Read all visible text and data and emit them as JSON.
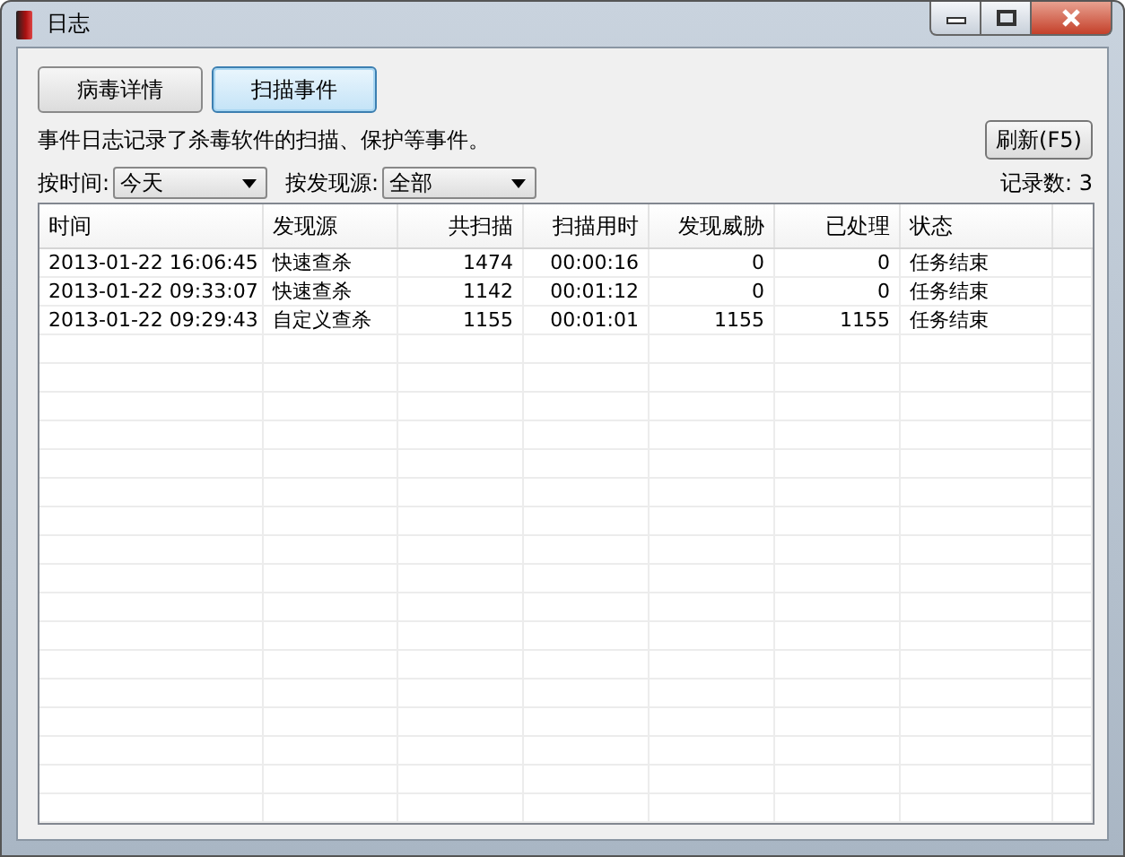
{
  "window": {
    "title": "日志"
  },
  "tabs": [
    {
      "label": "病毒详情",
      "selected": false
    },
    {
      "label": "扫描事件",
      "selected": true
    }
  ],
  "description": "事件日志记录了杀毒软件的扫描、保护等事件。",
  "refresh_button": "刷新(F5)",
  "filters": [
    {
      "label": "按时间:",
      "value": "今天"
    },
    {
      "label": "按发现源:",
      "value": "全部"
    }
  ],
  "record_count": "记录数: 3",
  "table": {
    "columns": [
      {
        "label": "时间",
        "kind": "text"
      },
      {
        "label": "发现源",
        "kind": "text"
      },
      {
        "label": "共扫描",
        "kind": "number"
      },
      {
        "label": "扫描用时",
        "kind": "number"
      },
      {
        "label": "发现威胁",
        "kind": "number"
      },
      {
        "label": "已处理",
        "kind": "number"
      },
      {
        "label": "状态",
        "kind": "text"
      }
    ],
    "rows": [
      [
        "2013-01-22 16:06:45",
        "快速查杀",
        "1474",
        "00:00:16",
        "0",
        "0",
        "任务结束"
      ],
      [
        "2013-01-22 09:33:07",
        "快速查杀",
        "1142",
        "00:01:12",
        "0",
        "0",
        "任务结束"
      ],
      [
        "2013-01-22 09:29:43",
        "自定义查杀",
        "1155",
        "00:01:01",
        "1155",
        "1155",
        "任务结束"
      ]
    ]
  }
}
